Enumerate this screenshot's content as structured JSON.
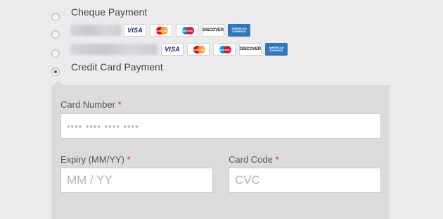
{
  "payment_options": [
    {
      "label": "Cheque Payment",
      "selected": false
    },
    {
      "label": "",
      "selected": false,
      "label_obscured": true,
      "card_logos": [
        "visa-icon",
        "mastercard-icon",
        "maestro-icon",
        "discover-icon",
        "amex-icon"
      ]
    },
    {
      "label": "",
      "selected": false,
      "label_obscured": true,
      "card_logos": [
        "visa-icon",
        "mastercard-icon",
        "maestro-icon",
        "discover-icon",
        "amex-icon"
      ]
    },
    {
      "label": "Credit Card Payment",
      "selected": true
    }
  ],
  "logos": {
    "visa": "VISA",
    "mastercard": "MasterCard",
    "maestro": "Maestro",
    "discover": "DISCOVER",
    "amex": "AMERICAN EXPRESS"
  },
  "form": {
    "card_number": {
      "label": "Card Number",
      "required": "*",
      "placeholder": "•••• •••• •••• ••••"
    },
    "expiry": {
      "label": "Expiry (MM/YY)",
      "required": "*",
      "placeholder": "MM / YY"
    },
    "card_code": {
      "label": "Card Code",
      "required": "*",
      "placeholder": "CVC"
    }
  },
  "colors": {
    "page_bg": "#edeaee",
    "panel_bg": "#dcdadc",
    "required_marker": "#c9302c"
  }
}
